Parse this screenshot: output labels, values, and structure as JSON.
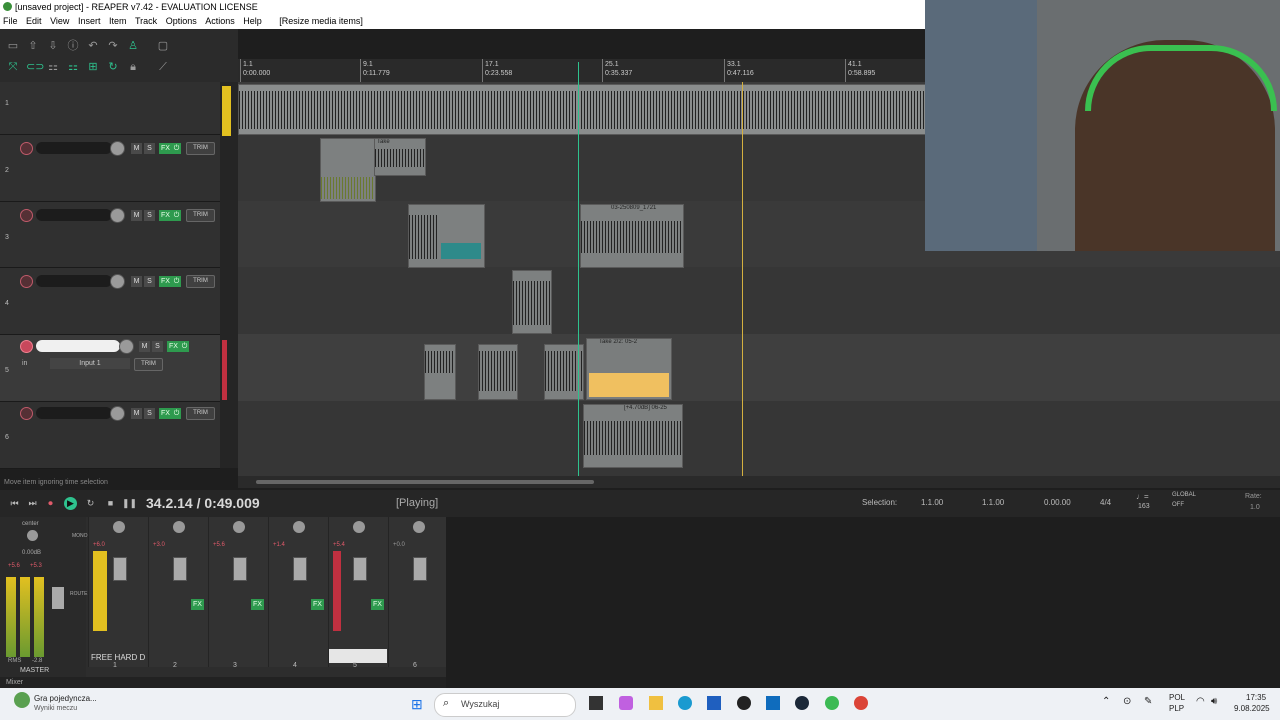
{
  "window": {
    "title": "[unsaved project] - REAPER v7.42 - EVALUATION LICENSE"
  },
  "menu": [
    "File",
    "Edit",
    "View",
    "Insert",
    "Item",
    "Track",
    "Options",
    "Actions",
    "Help",
    "[Resize media items]"
  ],
  "ruler": {
    "markers": [
      {
        "bar": "1.1",
        "time": "0:00.000"
      },
      {
        "bar": "9.1",
        "time": "0:11.779"
      },
      {
        "bar": "17.1",
        "time": "0:23.558"
      },
      {
        "bar": "25.1",
        "time": "0:35.337"
      },
      {
        "bar": "33.1",
        "time": "0:47.116"
      },
      {
        "bar": "41.1",
        "time": "0:58.895"
      }
    ]
  },
  "tracks": [
    {
      "num": "1"
    },
    {
      "num": "2",
      "trim": "TRIM",
      "fx": "FX"
    },
    {
      "num": "3",
      "trim": "TRIM",
      "fx": "FX"
    },
    {
      "num": "4",
      "trim": "TRIM",
      "fx": "FX"
    },
    {
      "num": "5",
      "trim": "TRIM",
      "fx": "FX",
      "input": "Input 1",
      "in_label": "in"
    },
    {
      "num": "6",
      "trim": "TRIM",
      "fx": "FX"
    }
  ],
  "items": {
    "take_label": "Take",
    "item_3b_label": "03-250809_1721",
    "item_5_label": "Take 2/2: 05-2",
    "item_6_label": "[+4.70dB] 06-25"
  },
  "status": {
    "hint": "Move item ignoring time selection"
  },
  "transport": {
    "position": "34.2.14 / 0:49.009",
    "state": "[Playing]",
    "selection_label": "Selection:",
    "sel_start": "1.1.00",
    "sel_end": "1.1.00",
    "sel_len": "0.00.00",
    "time_sig": "4/4",
    "bpm": "163",
    "global": "GLOBAL",
    "global_state": "OFF",
    "rate_label": "Rate:",
    "rate": "1.0"
  },
  "mixer": {
    "master_label": "MASTER",
    "center": "center",
    "master_db": "0.00dB",
    "master_peaks": [
      "+5.6",
      "+5.3"
    ],
    "rms": "RMS",
    "rms_val": "-2.8",
    "route": "ROUTE",
    "mono": "MONO",
    "channels": [
      {
        "num": "1",
        "peak": "+6.0",
        "name": "FREE HARD D"
      },
      {
        "num": "2",
        "peak": "+3.0",
        "name": ""
      },
      {
        "num": "3",
        "peak": "+5.6",
        "name": ""
      },
      {
        "num": "4",
        "peak": "+1.4",
        "name": ""
      },
      {
        "num": "5",
        "peak": "+5.4",
        "name": ""
      },
      {
        "num": "6",
        "peak": "+0.0",
        "name": ""
      }
    ],
    "tab": "Mixer"
  },
  "taskbar": {
    "notif_title": "Gra pojedyncza...",
    "notif_sub": "Wyniki meczu",
    "search": "Wyszukaj",
    "lang1": "POL",
    "lang2": "PLP",
    "time": "17:35",
    "date": "9.08.2025"
  },
  "colors": {
    "accent_fx": "#2e9a4e",
    "record": "#c05a6a",
    "playhead": "#2ec28e",
    "edit_cursor": "#d4b040"
  }
}
